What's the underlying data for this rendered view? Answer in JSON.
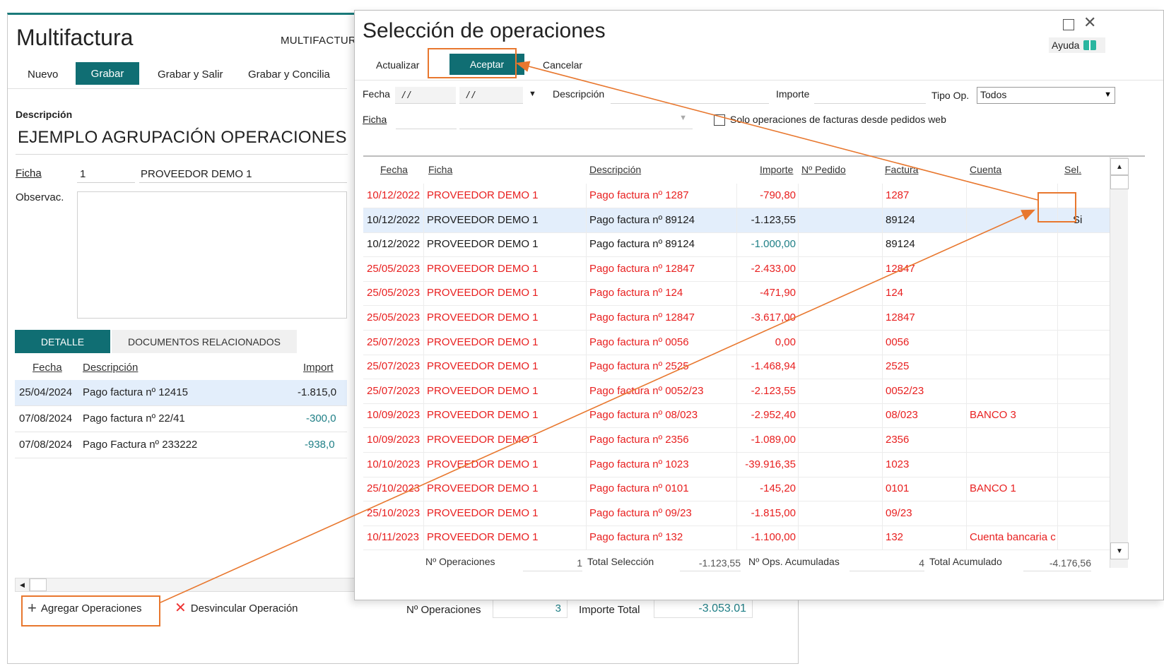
{
  "main_window": {
    "title": "Multifactura",
    "company": "MULTIFACTUR",
    "toolbar": {
      "new_label": "Nuevo",
      "save_label": "Grabar",
      "save_exit_label": "Grabar y Salir",
      "save_reconcile_label": "Grabar y Concilia"
    },
    "description_label": "Descripción",
    "description_value": "EJEMPLO AGRUPACIÓN OPERACIONES",
    "ficha_label": "Ficha",
    "ficha_code": "1",
    "ficha_name": "PROVEEDOR DEMO 1",
    "observ_label": "Observac.",
    "tabs": {
      "detail": "DETALLE",
      "related_docs": "DOCUMENTOS RELACIONADOS"
    },
    "grid_headers": {
      "fecha": "Fecha",
      "descripcion": "Descripción",
      "importe": "Import"
    },
    "grid_rows": [
      {
        "fecha": "25/04/2024",
        "descripcion": "Pago factura nº 12415",
        "importe": "-1.815,0"
      },
      {
        "fecha": "07/08/2024",
        "descripcion": "Pago factura nº 22/41",
        "importe": "-300,0"
      },
      {
        "fecha": "07/08/2024",
        "descripcion": "Pago Factura nº 233222",
        "importe": "-938,0"
      }
    ],
    "bottom_bar": {
      "add_ops_label": "Agregar Operaciones",
      "unlink_label": "Desvincular Operación",
      "n_ops_label": "Nº Operaciones",
      "n_ops_value": "3",
      "total_label": "Importe Total",
      "total_value": "-3.053.01"
    }
  },
  "dialog": {
    "title": "Selección de operaciones",
    "help_label": "Ayuda",
    "toolbar": {
      "refresh_label": "Actualizar",
      "accept_label": "Aceptar",
      "cancel_label": "Cancelar"
    },
    "filters": {
      "fecha_label": "Fecha",
      "fecha_from": "/ /",
      "fecha_to": "/ /",
      "descripcion_label": "Descripción",
      "importe_label": "Importe",
      "tipo_label": "Tipo Op.",
      "tipo_value": "Todos",
      "ficha_label": "Ficha",
      "web_orders_label": "Solo operaciones de facturas desde pedidos web"
    },
    "columns": {
      "fecha": "Fecha",
      "ficha": "Ficha",
      "descripcion": "Descripción",
      "importe": "Importe",
      "pedido": "Nº Pedido",
      "factura": "Factura",
      "cuenta": "Cuenta",
      "sel": "Sel."
    },
    "rows": [
      {
        "fecha": "10/12/2022",
        "ficha": "PROVEEDOR DEMO 1",
        "descripcion": "Pago factura nº 1287",
        "importe": "-790,80",
        "pedido": "",
        "factura": "1287",
        "cuenta": "",
        "sel": "",
        "color": "red"
      },
      {
        "fecha": "10/12/2022",
        "ficha": "PROVEEDOR DEMO 1",
        "descripcion": "Pago factura nº 89124",
        "importe": "-1.123,55",
        "pedido": "",
        "factura": "89124",
        "cuenta": "",
        "sel": "Si",
        "color": "black",
        "selected": true
      },
      {
        "fecha": "10/12/2022",
        "ficha": "PROVEEDOR DEMO 1",
        "descripcion": "Pago factura nº 89124",
        "importe": "-1.000,00",
        "pedido": "",
        "factura": "89124",
        "cuenta": "",
        "sel": "",
        "color": "black",
        "importe_color": "#1f7f86"
      },
      {
        "fecha": "25/05/2023",
        "ficha": "PROVEEDOR DEMO 1",
        "descripcion": "Pago factura nº 12847",
        "importe": "-2.433,00",
        "pedido": "",
        "factura": "12847",
        "cuenta": "",
        "sel": "",
        "color": "red"
      },
      {
        "fecha": "25/05/2023",
        "ficha": "PROVEEDOR DEMO 1",
        "descripcion": "Pago factura nº 124",
        "importe": "-471,90",
        "pedido": "",
        "factura": "124",
        "cuenta": "",
        "sel": "",
        "color": "red"
      },
      {
        "fecha": "25/05/2023",
        "ficha": "PROVEEDOR DEMO 1",
        "descripcion": "Pago factura nº 12847",
        "importe": "-3.617,00",
        "pedido": "",
        "factura": "12847",
        "cuenta": "",
        "sel": "",
        "color": "red"
      },
      {
        "fecha": "25/07/2023",
        "ficha": "PROVEEDOR DEMO 1",
        "descripcion": "Pago factura nº 0056",
        "importe": "0,00",
        "pedido": "",
        "factura": "0056",
        "cuenta": "",
        "sel": "",
        "color": "red"
      },
      {
        "fecha": "25/07/2023",
        "ficha": "PROVEEDOR DEMO 1",
        "descripcion": "Pago factura nº 2525",
        "importe": "-1.468,94",
        "pedido": "",
        "factura": "2525",
        "cuenta": "",
        "sel": "",
        "color": "red"
      },
      {
        "fecha": "25/07/2023",
        "ficha": "PROVEEDOR DEMO 1",
        "descripcion": "Pago factura nº 0052/23",
        "importe": "-2.123,55",
        "pedido": "",
        "factura": "0052/23",
        "cuenta": "",
        "sel": "",
        "color": "red"
      },
      {
        "fecha": "10/09/2023",
        "ficha": "PROVEEDOR DEMO 1",
        "descripcion": "Pago factura nº 08/023",
        "importe": "-2.952,40",
        "pedido": "",
        "factura": "08/023",
        "cuenta": "BANCO 3",
        "sel": "",
        "color": "red"
      },
      {
        "fecha": "10/09/2023",
        "ficha": "PROVEEDOR DEMO 1",
        "descripcion": "Pago factura nº 2356",
        "importe": "-1.089,00",
        "pedido": "",
        "factura": "2356",
        "cuenta": "",
        "sel": "",
        "color": "red"
      },
      {
        "fecha": "10/10/2023",
        "ficha": "PROVEEDOR DEMO 1",
        "descripcion": "Pago factura nº 1023",
        "importe": "-39.916,35",
        "pedido": "",
        "factura": "1023",
        "cuenta": "",
        "sel": "",
        "color": "red"
      },
      {
        "fecha": "25/10/2023",
        "ficha": "PROVEEDOR DEMO 1",
        "descripcion": "Pago factura nº 0101",
        "importe": "-145,20",
        "pedido": "",
        "factura": "0101",
        "cuenta": "BANCO 1",
        "sel": "",
        "color": "red"
      },
      {
        "fecha": "25/10/2023",
        "ficha": "PROVEEDOR DEMO 1",
        "descripcion": "Pago factura nº 09/23",
        "importe": "-1.815,00",
        "pedido": "",
        "factura": "09/23",
        "cuenta": "",
        "sel": "",
        "color": "red"
      },
      {
        "fecha": "10/11/2023",
        "ficha": "PROVEEDOR DEMO 1",
        "descripcion": "Pago factura nº 132",
        "importe": "-1.100,00",
        "pedido": "",
        "factura": "132",
        "cuenta": "Cuenta bancaria c",
        "sel": "",
        "color": "red"
      }
    ],
    "footer": {
      "n_ops_label": "Nº Operaciones",
      "n_ops_value": "1",
      "total_sel_label": "Total Selección",
      "total_sel_value": "-1.123,55",
      "n_acc_label": "Nº Ops. Acumuladas",
      "n_acc_value": "4",
      "total_acc_label": "Total Acumulado",
      "total_acc_value": "-4.176,56"
    }
  },
  "colors": {
    "teal": "#106e73",
    "highlight": "#e8772e",
    "row_red": "#e81f1f",
    "selected_row": "#e3eefb"
  },
  "icons": {
    "maximize": "maximize-icon",
    "close": "close-icon",
    "help": "book-icon",
    "add": "plus-icon",
    "unlink": "x-mark-icon"
  }
}
